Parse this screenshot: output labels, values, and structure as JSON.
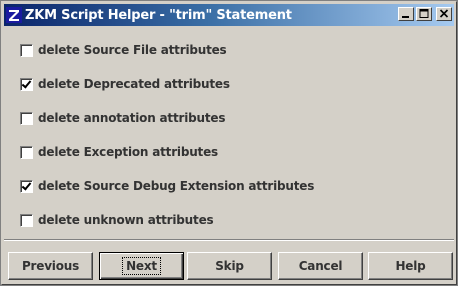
{
  "window": {
    "title": "ZKM Script Helper - \"trim\" Statement",
    "app_icon_letter": "Z",
    "controls": {
      "minimize_icon": "minimize-icon",
      "maximize_icon": "maximize-icon",
      "close_icon": "close-icon"
    }
  },
  "options": [
    {
      "label": "delete Source File attributes",
      "checked": false
    },
    {
      "label": "delete Deprecated attributes",
      "checked": true
    },
    {
      "label": "delete annotation attributes",
      "checked": false
    },
    {
      "label": "delete Exception attributes",
      "checked": false
    },
    {
      "label": "delete Source Debug Extension attributes",
      "checked": true
    },
    {
      "label": "delete unknown attributes",
      "checked": false
    }
  ],
  "buttons": {
    "previous": "Previous",
    "next": "Next",
    "skip": "Skip",
    "cancel": "Cancel",
    "help": "Help"
  },
  "colors": {
    "titlebar_start": "#0a246a",
    "titlebar_end": "#a6caf0",
    "window_bg": "#d4d0c8"
  }
}
